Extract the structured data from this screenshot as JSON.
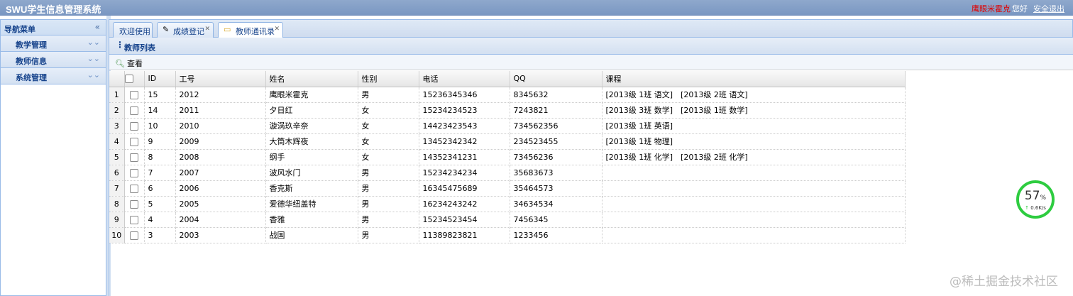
{
  "app": {
    "title": "SWU学生信息管理系统",
    "user_name": "鹰眼米霍克",
    "greeting": "您好",
    "logout": "安全退出"
  },
  "sidebar": {
    "title": "导航菜单",
    "items": [
      {
        "label": "教学管理"
      },
      {
        "label": "教师信息"
      },
      {
        "label": "系统管理"
      }
    ]
  },
  "tabs": [
    {
      "label": "欢迎使用"
    },
    {
      "label": "成绩登记"
    },
    {
      "label": "教师通讯录"
    }
  ],
  "panel": {
    "title": "教师列表",
    "view_button": "查看"
  },
  "grid": {
    "columns": [
      "ID",
      "工号",
      "姓名",
      "性别",
      "电话",
      "QQ",
      "课程"
    ],
    "rows": [
      {
        "n": "1",
        "id": "15",
        "no": "2012",
        "name": "鹰眼米霍克",
        "sex": "男",
        "phone": "15236345346",
        "qq": "8345632",
        "course": "[2013级 1班 语文]　[2013级 2班 语文]"
      },
      {
        "n": "2",
        "id": "14",
        "no": "2011",
        "name": "夕日红",
        "sex": "女",
        "phone": "15234234523",
        "qq": "7243821",
        "course": "[2013级 3班 数学]　[2013级 1班 数学]"
      },
      {
        "n": "3",
        "id": "10",
        "no": "2010",
        "name": "漩涡玖辛奈",
        "sex": "女",
        "phone": "14423423543",
        "qq": "734562356",
        "course": "[2013级 1班 英语]"
      },
      {
        "n": "4",
        "id": "9",
        "no": "2009",
        "name": "大筒木辉夜",
        "sex": "女",
        "phone": "13452342342",
        "qq": "234523455",
        "course": "[2013级 1班 物理]"
      },
      {
        "n": "5",
        "id": "8",
        "no": "2008",
        "name": "纲手",
        "sex": "女",
        "phone": "14352341231",
        "qq": "73456236",
        "course": "[2013级 1班 化学]　[2013级 2班 化学]"
      },
      {
        "n": "6",
        "id": "7",
        "no": "2007",
        "name": "波风水门",
        "sex": "男",
        "phone": "15234234234",
        "qq": "35683673",
        "course": ""
      },
      {
        "n": "7",
        "id": "6",
        "no": "2006",
        "name": "香克斯",
        "sex": "男",
        "phone": "16345475689",
        "qq": "35464573",
        "course": ""
      },
      {
        "n": "8",
        "id": "5",
        "no": "2005",
        "name": "爱德华纽盖特",
        "sex": "男",
        "phone": "16234243242",
        "qq": "34634534",
        "course": ""
      },
      {
        "n": "9",
        "id": "4",
        "no": "2004",
        "name": "香雅",
        "sex": "男",
        "phone": "15234523454",
        "qq": "7456345",
        "course": ""
      },
      {
        "n": "10",
        "id": "3",
        "no": "2003",
        "name": "战国",
        "sex": "男",
        "phone": "11389823821",
        "qq": "1233456",
        "course": ""
      }
    ]
  },
  "speed_widget": {
    "percent": "57",
    "percent_unit": "%",
    "rate": "0.6K/s"
  },
  "watermark": "@稀土掘金技术社区"
}
